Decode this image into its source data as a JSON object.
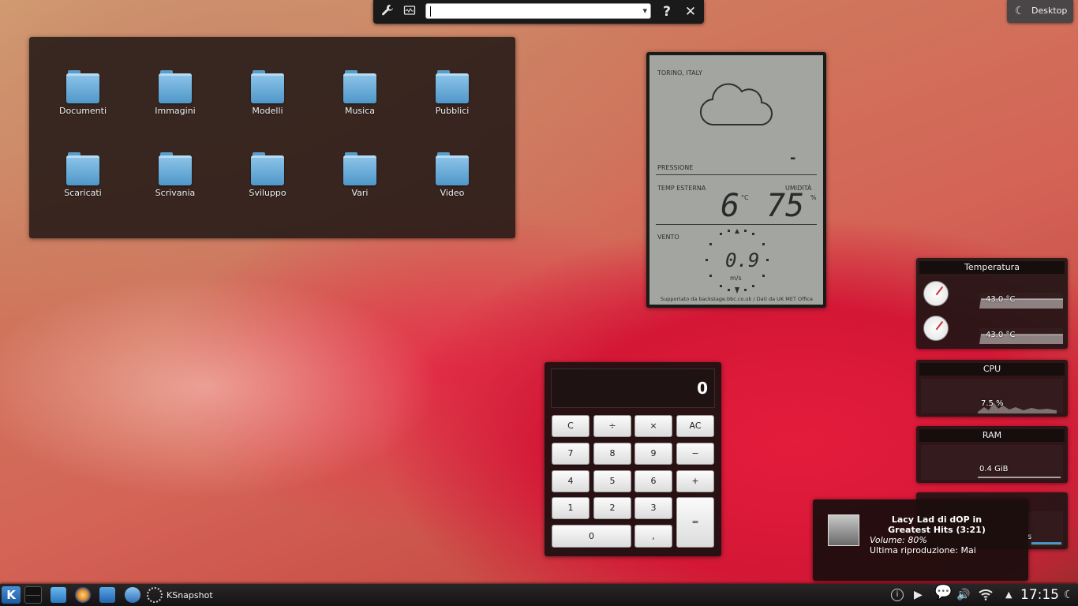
{
  "krunner": {
    "input_value": "",
    "help_label": "?",
    "close_label": "✕"
  },
  "desktop_button": {
    "label": "Desktop"
  },
  "folders": [
    {
      "label": "Documenti"
    },
    {
      "label": "Immagini"
    },
    {
      "label": "Modelli"
    },
    {
      "label": "Musica"
    },
    {
      "label": "Pubblici"
    },
    {
      "label": "Scaricati"
    },
    {
      "label": "Scrivania"
    },
    {
      "label": "Sviluppo"
    },
    {
      "label": "Vari"
    },
    {
      "label": "Video"
    }
  ],
  "weather": {
    "location": "TORINO, ITALY",
    "pressure_label": "PRESSIONE",
    "pressure_value": "-",
    "temp_label": "TEMP ESTERNA",
    "temp_value": "6",
    "temp_unit": "°C",
    "humidity_label": "UMIDITÀ",
    "humidity_value": "75",
    "humidity_unit": "%",
    "wind_label": "VENTO",
    "wind_value": "0.9",
    "wind_unit": "m/s",
    "credits": "Supportato da backstage.bbc.co.uk / Dati da UK MET Office"
  },
  "calculator": {
    "display": "0",
    "keys": {
      "c": "C",
      "div": "÷",
      "mul": "×",
      "ac": "AC",
      "k7": "7",
      "k8": "8",
      "k9": "9",
      "minus": "−",
      "k4": "4",
      "k5": "5",
      "k6": "6",
      "plus": "+",
      "k1": "1",
      "k2": "2",
      "k3": "3",
      "eq": "=",
      "k0": "0",
      "comma": ","
    }
  },
  "monitors": {
    "temperature": {
      "title": "Temperatura",
      "sensor1": "43.0 °C",
      "sensor2": "43.0 °C"
    },
    "cpu": {
      "title": "CPU",
      "value": "7.5 %"
    },
    "ram": {
      "title": "RAM",
      "value": "0.4 GiB"
    },
    "net": {
      "value": "s"
    }
  },
  "notification": {
    "title": "Lacy Lad di dOP in Greatest Hits (3:21)",
    "volume": "Volume: 80%",
    "last_played": "Ultima riproduzione: Mai"
  },
  "taskbar": {
    "task_label": "KSnapshot",
    "clock": "17:15"
  },
  "colors": {
    "panel_bg": "#141213",
    "folder_blue": "#4f97c9",
    "lcd_bg": "#a3a5a0"
  }
}
